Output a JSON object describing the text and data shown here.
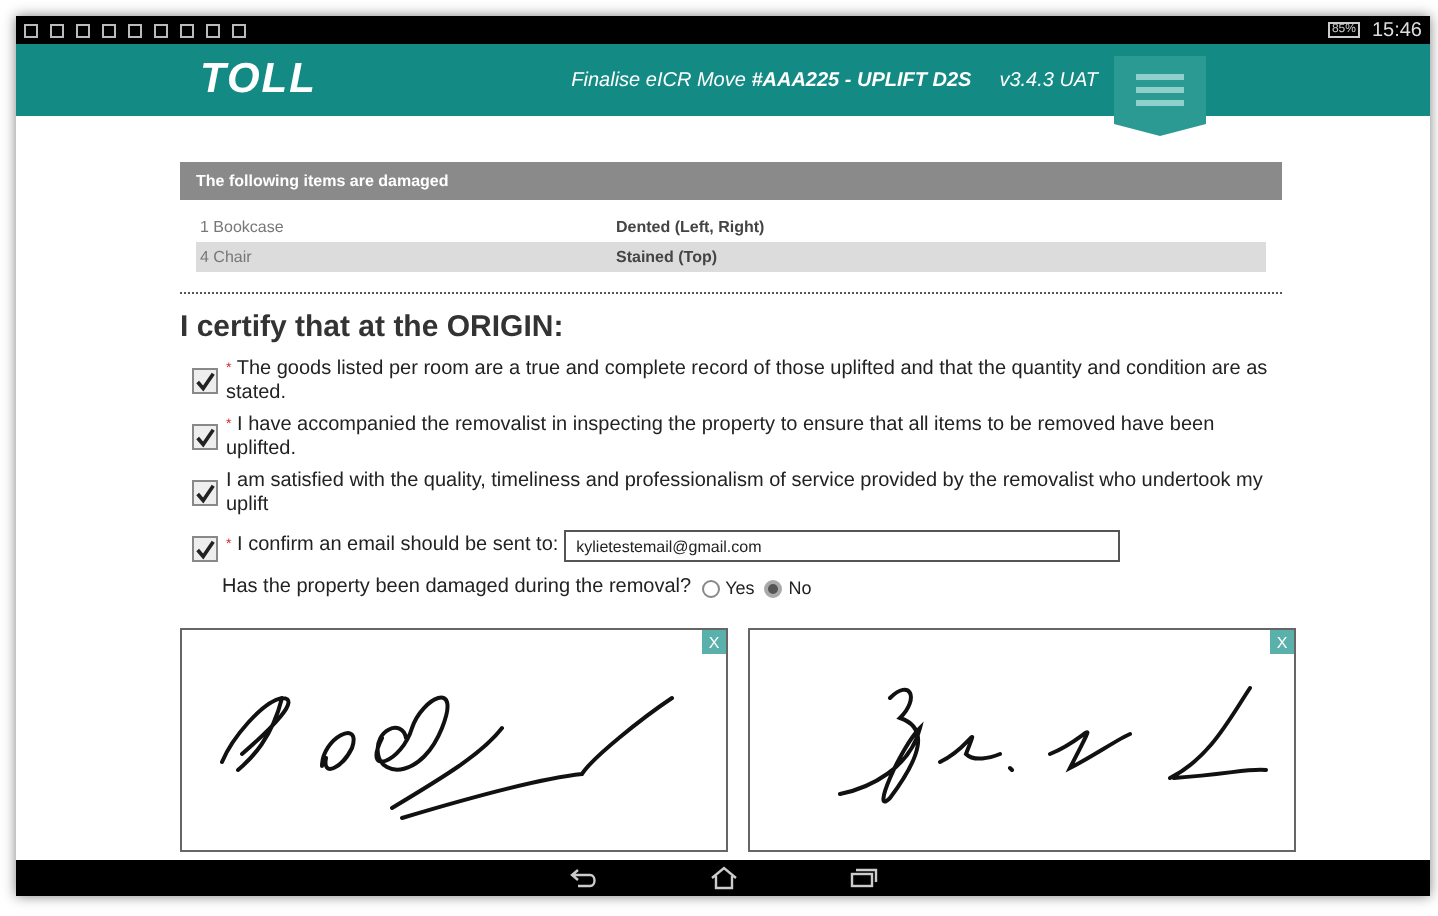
{
  "status_bar": {
    "battery": "85%",
    "time": "15:46"
  },
  "header": {
    "logo": "TOLL",
    "title": "Finalise eICR Move **#AAA225 - UPLIFT D2S**",
    "version": "v3.4.3 UAT"
  },
  "damaged_panel": {
    "title": "The following items are damaged",
    "rows": [
      {
        "item": "1 Bookcase",
        "damage": "Dented (Left, Right)"
      },
      {
        "item": "4 Chair",
        "damage": "Stained (Top)"
      }
    ]
  },
  "certify": {
    "heading": "I certify that at the ORIGIN:",
    "items": [
      {
        "kind": "statement",
        "required_mark": "*",
        "label": "The goods listed per room are a true and complete record of those uplifted and that the quantity and condition are as stated.",
        "checked": true
      },
      {
        "kind": "statement",
        "required_mark": "*",
        "label": "I have accompanied the removalist in inspecting the property to ensure that all items to be removed have been uplifted.",
        "checked": true
      },
      {
        "kind": "statement",
        "label": "I am satisfied with the quality, timeliness and professionalism of service provided by the removalist who undertook my uplift",
        "checked": true
      },
      {
        "kind": "email",
        "required_mark": "*",
        "label": "I confirm an email should be sent to:",
        "value": "kylietestemail@gmail.com",
        "checked": true
      }
    ],
    "damage_question": {
      "label": "Has the property been damaged during the removal?",
      "options": [
        {
          "label": "Yes",
          "selected": false
        },
        {
          "label": "No",
          "selected": true
        }
      ]
    }
  },
  "signatures": [
    {
      "clear": "X"
    },
    {
      "clear": "X"
    }
  ]
}
